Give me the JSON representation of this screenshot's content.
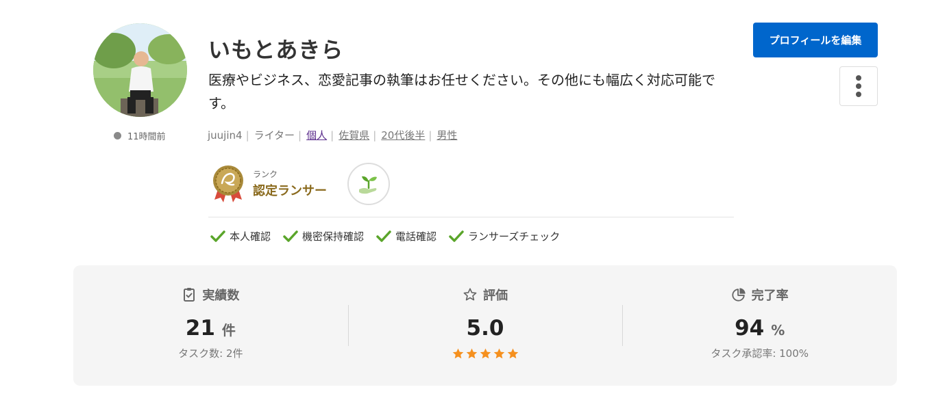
{
  "profile": {
    "name": "いもとあきら",
    "catchphrase": "医療やビジネス、恋愛記事の執筆はお任せください。その他にも幅広く対応可能です。",
    "last_active": "11時間前",
    "meta": {
      "username": "juujin4",
      "occupation": "ライター",
      "type": "個人",
      "prefecture": "佐賀県",
      "age": "20代後半",
      "gender": "男性"
    },
    "rank": {
      "label": "ランク",
      "value": "認定ランサー"
    },
    "verifications": [
      "本人確認",
      "機密保持確認",
      "電話確認",
      "ランサーズチェック"
    ]
  },
  "actions": {
    "edit_label": "プロフィールを編集"
  },
  "stats": {
    "achievements": {
      "label": "実績数",
      "value": "21",
      "unit": "件",
      "sub": "タスク数: 2件"
    },
    "rating": {
      "label": "評価",
      "value": "5.0",
      "stars": 5
    },
    "completion": {
      "label": "完了率",
      "value": "94",
      "unit": "%",
      "sub": "タスク承認率: 100%"
    }
  },
  "colors": {
    "accent": "#0066cc",
    "check": "#5aa52a",
    "star": "#f5901e",
    "rank_gold": "#8a6a1d"
  }
}
